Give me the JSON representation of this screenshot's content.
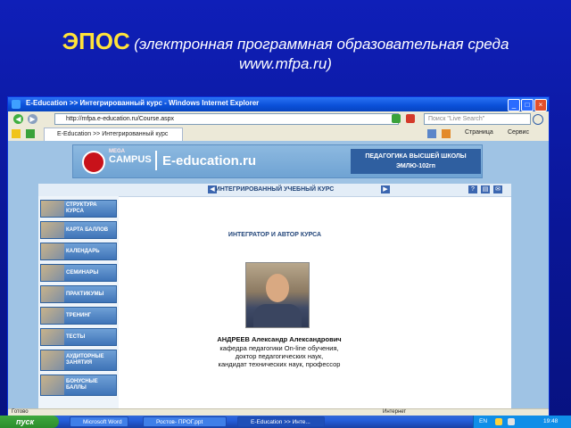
{
  "slide": {
    "title": "ЭПОС",
    "subtitle": "(электронная программная образовательная среда",
    "url": "www.mfpa.ru)"
  },
  "browser": {
    "window_title": "E-Education >> Интегрированный курс - Windows Internet Explorer",
    "address": "http://mfpa.e-education.ru/Course.aspx",
    "search_placeholder": "Поиск \"Live Search\"",
    "tab_title": "E-Education >> Интегрированный курс",
    "page_menu": "Страница",
    "tools_menu": "Сервис",
    "status_left": "Готово",
    "status_zone": "Интернет"
  },
  "site": {
    "logo_small": "MEGA",
    "logo_campus": "CAMPUS",
    "logo_edu": "E-education.ru",
    "tagline_1": "ПЕДАГОГИКА ВЫСШЕЙ ШКОЛЫ",
    "tagline_2": "ЭМЛЮ-102гп",
    "course_header": "ИНТЕГРИРОВАННЫЙ УЧЕБНЫЙ КУРС",
    "menu": [
      {
        "label": "СТРУКТУРА КУРСА"
      },
      {
        "label": "КАРТА БАЛЛОВ"
      },
      {
        "label": "КАЛЕНДАРЬ"
      },
      {
        "label": "СЕМИНАРЫ"
      },
      {
        "label": "ПРАКТИКУМЫ"
      },
      {
        "label": "ТРЕНИНГ"
      },
      {
        "label": "ТЕСТЫ"
      },
      {
        "label": "АУДИТОРНЫЕ ЗАНЯТИЯ"
      },
      {
        "label": "БОНУСНЫЕ БАЛЛЫ"
      }
    ],
    "author_section_title": "ИНТЕГРАТОР И АВТОР КУРСА",
    "author_name": "АНДРЕЕВ Александр Александрович",
    "author_desc": [
      "кафедра педагогики On-line обучения,",
      "доктор педагогических наук,",
      "кандидат технических наук, профессор"
    ]
  },
  "taskbar": {
    "start_label": "пуск",
    "tasks": [
      {
        "label": "Microsoft Word"
      },
      {
        "label": "Ростов- ПРОГ.ppt"
      },
      {
        "label": "E-Education >> Инте..."
      }
    ],
    "lang": "EN",
    "time": "19:48"
  },
  "colors": {
    "slide_bg": "#0a1696",
    "title_yellow": "#ffe33a",
    "xp_blue": "#245edb",
    "site_blue": "#3f74b8"
  }
}
